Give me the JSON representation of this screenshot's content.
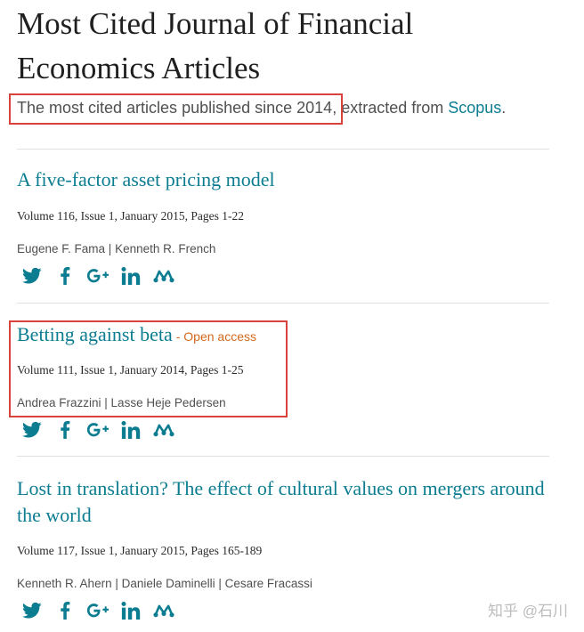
{
  "page": {
    "title": "Most Cited Journal of Financial Economics Articles",
    "subtitle_prefix": "The most cited articles published since 2014,",
    "subtitle_middle": " extracted from ",
    "subtitle_link": "Scopus",
    "subtitle_suffix": "."
  },
  "articles": [
    {
      "title": "A five-factor asset pricing model",
      "open_access": "",
      "meta": "Volume 116, Issue 1, January 2015, Pages 1-22",
      "authors": "Eugene F. Fama | Kenneth R. French"
    },
    {
      "title": "Betting against beta",
      "open_access": "- Open access",
      "meta": "Volume 111, Issue 1, January 2014, Pages 1-25",
      "authors": "Andrea Frazzini | Lasse Heje Pedersen"
    },
    {
      "title": "Lost in translation? The effect of cultural values on mergers around the world",
      "open_access": "",
      "meta": "Volume 117, Issue 1, January 2015, Pages 165-189",
      "authors": "Kenneth R. Ahern | Daniele Daminelli | Cesare Fracassi"
    }
  ],
  "share_icons": [
    "twitter-icon",
    "facebook-icon",
    "google-plus-icon",
    "linkedin-icon",
    "mendeley-icon"
  ],
  "colors": {
    "link": "#0c7d91",
    "open_access": "#d2691e",
    "highlight": "#d9413b"
  },
  "watermark": "知乎 @石川"
}
